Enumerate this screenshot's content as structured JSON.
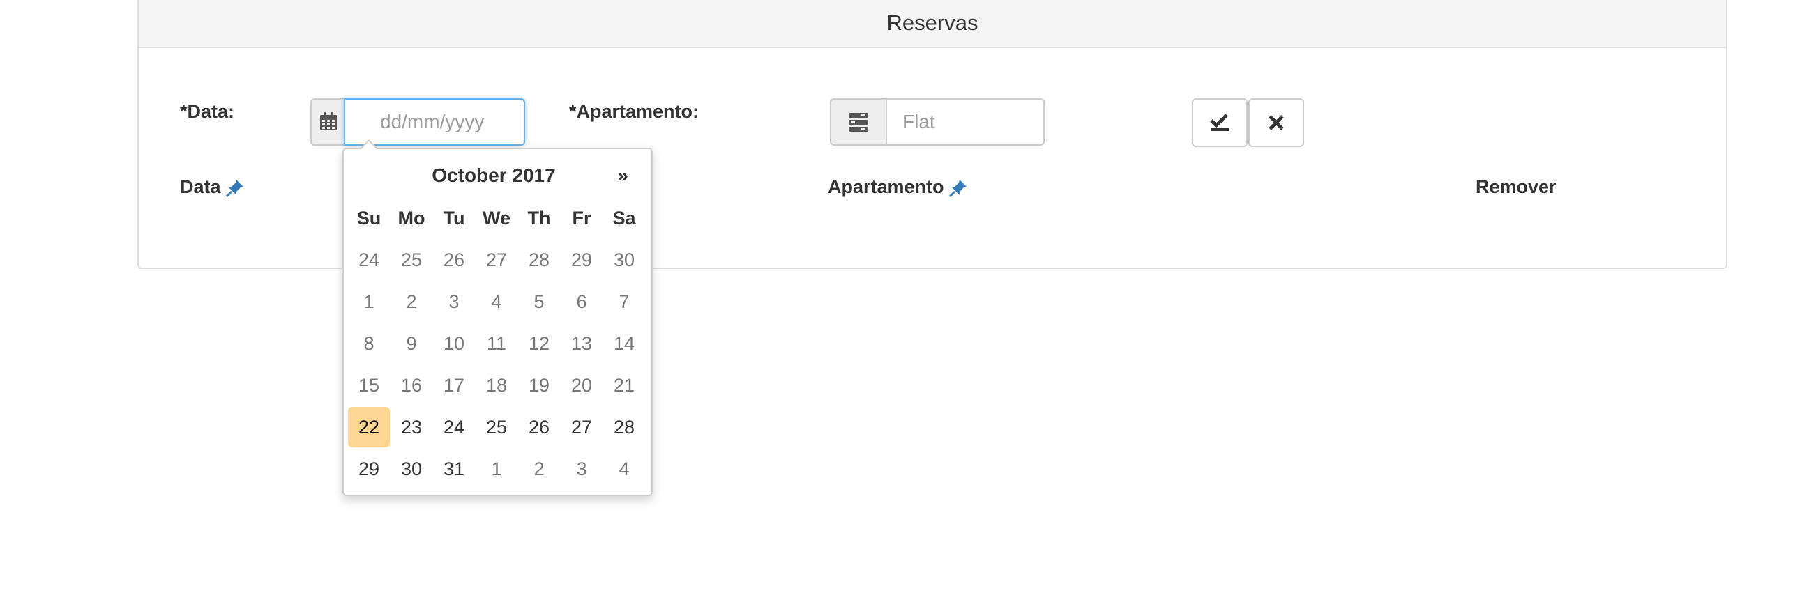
{
  "panel": {
    "title": "Reservas"
  },
  "form": {
    "date_label": "*Data:",
    "date_placeholder": "dd/mm/yyyy",
    "apartment_label": "*Apartamento:",
    "apartment_placeholder": "Flat"
  },
  "table": {
    "headers": [
      "Data",
      "Apartamento",
      "Remover"
    ]
  },
  "datepicker": {
    "title": "October 2017",
    "next": "»",
    "weekdays": [
      "Su",
      "Mo",
      "Tu",
      "We",
      "Th",
      "Fr",
      "Sa"
    ],
    "weeks": [
      [
        "24",
        "25",
        "26",
        "27",
        "28",
        "29",
        "30"
      ],
      [
        "1",
        "2",
        "3",
        "4",
        "5",
        "6",
        "7"
      ],
      [
        "8",
        "9",
        "10",
        "11",
        "12",
        "13",
        "14"
      ],
      [
        "15",
        "16",
        "17",
        "18",
        "19",
        "20",
        "21"
      ],
      [
        "22",
        "23",
        "24",
        "25",
        "26",
        "27",
        "28"
      ],
      [
        "29",
        "30",
        "31",
        "1",
        "2",
        "3",
        "4"
      ]
    ],
    "today": "22",
    "today_color": "#fdd692"
  },
  "icons": {
    "date_addon": "calendar-icon",
    "apartment_addon": "list-icon",
    "confirm": "check-icon",
    "cancel": "close-icon",
    "pin": "pin-icon"
  },
  "colors": {
    "accent": "#337ab7",
    "focus_border": "#66afe9"
  }
}
